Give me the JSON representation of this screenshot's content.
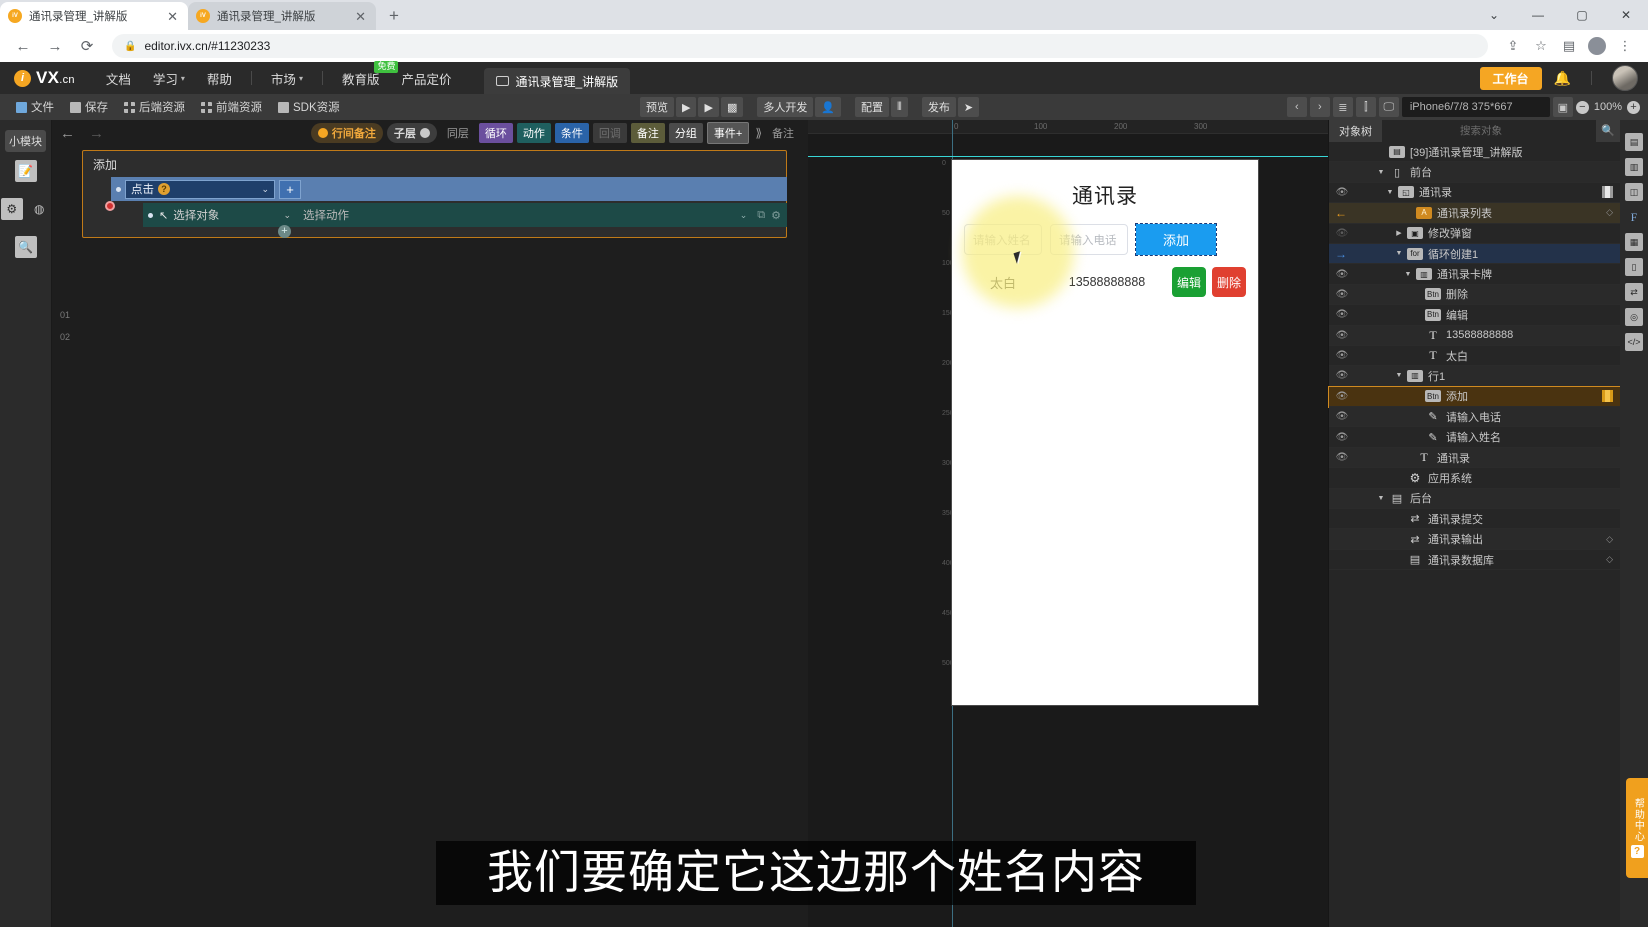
{
  "browser": {
    "tabs": [
      {
        "title": "通讯录管理_讲解版",
        "close": "✕",
        "favicon": "ivx-favicon",
        "active": true
      },
      {
        "title": "通讯录管理_讲解版",
        "close": "✕",
        "favicon": "ivx-favicon",
        "active": false
      }
    ],
    "new_tab_label": "+",
    "window_controls": {
      "minimize": "—",
      "maximize": "▢",
      "close": "✕",
      "chevron": "⌄"
    },
    "nav": {
      "back": "←",
      "forward": "→",
      "reload": "⟳",
      "lock": "🔒"
    },
    "url": "editor.ivx.cn/#11230233",
    "end_icons": {
      "share": "⇪",
      "star": "☆",
      "panel": "▤",
      "profile": "profile-avatar",
      "menu": "⋮"
    }
  },
  "topnav": {
    "logo_mark": "i",
    "logo_text": "VX",
    "logo_suffix": ".cn",
    "items": [
      {
        "label": "文档",
        "caret": false
      },
      {
        "label": "学习",
        "caret": true
      },
      {
        "label": "帮助",
        "caret": false
      },
      {
        "label": "市场",
        "caret": true
      },
      {
        "label": "教育版",
        "caret": false,
        "badge": "免费"
      },
      {
        "label": "产品定价",
        "caret": false
      }
    ],
    "project_tab": "通讯录管理_讲解版",
    "workbench_button": "工作台",
    "bell_icon": "bell-icon",
    "avatar": "user-avatar"
  },
  "toolbar": {
    "left_items": [
      {
        "label": "文件",
        "icon": "folder-icon"
      },
      {
        "label": "保存",
        "icon": "save-icon"
      },
      {
        "label": "后端资源",
        "icon": "backend-resource-icon"
      },
      {
        "label": "前端资源",
        "icon": "frontend-resource-icon"
      },
      {
        "label": "SDK资源",
        "icon": "sdk-resource-icon"
      }
    ],
    "center_items": [
      {
        "label": "预览",
        "icon": "preview-icon"
      },
      {
        "label": "",
        "icon": "play-icon"
      },
      {
        "label": "",
        "icon": "play-alt-icon"
      },
      {
        "label": "",
        "icon": "qr-icon"
      },
      {
        "label": "多人开发",
        "icon": "multi-user-icon"
      },
      {
        "label": "",
        "icon": "user-icon"
      },
      {
        "label": "配置",
        "icon": "config-icon"
      },
      {
        "label": "",
        "icon": "sliders-icon"
      },
      {
        "label": "发布",
        "icon": "publish-icon"
      },
      {
        "label": "",
        "icon": "send-icon"
      }
    ],
    "right": {
      "prev": "‹",
      "next": "›",
      "align_icon": "align-icon",
      "distribute_icon": "distribute-icon",
      "device_icon": "device-icon",
      "device": "iPhone6/7/8 375*667",
      "screenshot_icon": "screenshot-icon",
      "zoom_out": "−",
      "zoom_level": "100%",
      "zoom_in": "+"
    }
  },
  "left_rail": {
    "tab": "小模块",
    "icons": [
      "edit-chart-icon",
      "sliders-icon",
      "palette-icon",
      "inspect-icon"
    ]
  },
  "event_editor": {
    "back_arrow": "←",
    "forward_arrow": "→",
    "toggles": [
      {
        "label": "行间备注",
        "style": "amber"
      },
      {
        "label": "子层",
        "style": "gray"
      }
    ],
    "tags": [
      {
        "label": "同层",
        "style": "plain"
      },
      {
        "label": "循环",
        "style": "loop"
      },
      {
        "label": "动作",
        "style": "action"
      },
      {
        "label": "条件",
        "style": "cond"
      },
      {
        "label": "回调",
        "style": "callback"
      },
      {
        "label": "备注",
        "style": "note"
      },
      {
        "label": "分组",
        "style": "group"
      },
      {
        "label": "事件+",
        "style": "event"
      }
    ],
    "more_chevron": "⟫",
    "more_label": "备注",
    "card_title": "添加",
    "row_numbers": [
      "01",
      "02"
    ],
    "row1": {
      "event_name": "点击",
      "help": "?",
      "chevron": "⌄",
      "add": "+"
    },
    "row2": {
      "object_placeholder": "选择对象",
      "chevron": "⌄",
      "action_placeholder": "选择动作",
      "action_chevron": "⌄",
      "end_icons": [
        "copy-icon",
        "gear-icon"
      ]
    },
    "add_row": "+"
  },
  "stage": {
    "ruler_marks": [
      "0",
      "100",
      "200",
      "300"
    ],
    "ruler_v_marks": [
      "0",
      "50",
      "100",
      "150",
      "200",
      "250",
      "300",
      "350",
      "400",
      "450",
      "500"
    ],
    "phone": {
      "title": "通讯录",
      "name_placeholder": "请输入姓名",
      "phone_placeholder": "请输入电话",
      "add_button": "添加",
      "record": {
        "name": "太白",
        "phone": "13588888888",
        "edit_button": "编辑",
        "delete_button": "删除"
      }
    }
  },
  "tree": {
    "tab": "对象树",
    "search_placeholder": "搜索对象",
    "search_icon": "search-icon",
    "rows": [
      {
        "label": "[39]通讯录管理_讲解版",
        "indent": 2,
        "icon": "project-icon",
        "eye": false,
        "arrow": "",
        "mark": "",
        "end": ""
      },
      {
        "label": "前台",
        "indent": 2,
        "icon": "phone-icon",
        "eye": false,
        "arrow": "▼",
        "mark": "",
        "end": ""
      },
      {
        "label": "通讯录",
        "indent": 3,
        "icon": "page-icon",
        "eye": true,
        "arrow": "▼",
        "mark": "",
        "end": "book"
      },
      {
        "label": "通讯录列表",
        "indent": 5,
        "icon": "list-icon-orange",
        "eye": false,
        "arrow": "",
        "mark": "orange",
        "end": "dot"
      },
      {
        "label": "修改弹窗",
        "indent": 4,
        "icon": "popup-icon",
        "eye": "off",
        "arrow": "▶",
        "mark": "",
        "end": ""
      },
      {
        "label": "循环创建1",
        "indent": 4,
        "icon": "loop-icon",
        "eye": false,
        "arrow": "▼",
        "mark": "blue",
        "end": ""
      },
      {
        "label": "通讯录卡牌",
        "indent": 5,
        "icon": "card-icon",
        "eye": true,
        "arrow": "▼",
        "mark": "",
        "end": ""
      },
      {
        "label": "删除",
        "indent": 6,
        "icon": "button-icon",
        "eye": true,
        "arrow": "",
        "mark": "",
        "end": ""
      },
      {
        "label": "编辑",
        "indent": 6,
        "icon": "button-icon",
        "eye": true,
        "arrow": "",
        "mark": "",
        "end": ""
      },
      {
        "label": "13588888888",
        "indent": 6,
        "icon": "text-icon",
        "eye": true,
        "arrow": "",
        "mark": "",
        "end": ""
      },
      {
        "label": "太白",
        "indent": 6,
        "icon": "text-icon",
        "eye": true,
        "arrow": "",
        "mark": "",
        "end": ""
      },
      {
        "label": "行1",
        "indent": 4,
        "icon": "row-icon",
        "eye": true,
        "arrow": "▼",
        "mark": "",
        "end": ""
      },
      {
        "label": "添加",
        "indent": 6,
        "icon": "button-icon",
        "eye": true,
        "arrow": "",
        "mark": "",
        "end": "book-amber",
        "selected": true
      },
      {
        "label": "请输入电话",
        "indent": 6,
        "icon": "input-icon",
        "eye": true,
        "arrow": "",
        "mark": "",
        "end": ""
      },
      {
        "label": "请输入姓名",
        "indent": 6,
        "icon": "input-icon",
        "eye": true,
        "arrow": "",
        "mark": "",
        "end": ""
      },
      {
        "label": "通讯录",
        "indent": 5,
        "icon": "text-icon",
        "eye": true,
        "arrow": "",
        "mark": "",
        "end": ""
      },
      {
        "label": "应用系统",
        "indent": 4,
        "icon": "gear-icon",
        "eye": false,
        "arrow": "",
        "mark": "",
        "end": ""
      },
      {
        "label": "后台",
        "indent": 2,
        "icon": "server-icon",
        "eye": false,
        "arrow": "▼",
        "mark": "",
        "end": ""
      },
      {
        "label": "通讯录提交",
        "indent": 4,
        "icon": "service-icon",
        "eye": false,
        "arrow": "",
        "mark": "",
        "end": ""
      },
      {
        "label": "通讯录输出",
        "indent": 4,
        "icon": "service-icon",
        "eye": false,
        "arrow": "",
        "mark": "",
        "end": "dot"
      },
      {
        "label": "通讯录数据库",
        "indent": 4,
        "icon": "database-icon",
        "eye": false,
        "arrow": "",
        "mark": "",
        "end": "dot"
      }
    ]
  },
  "far_rail": {
    "icons": [
      "properties-icon",
      "styles-icon",
      "data-icon",
      "font-icon",
      "layers-icon",
      "mobile-icon",
      "transfer-icon",
      "component-icon",
      "code-icon"
    ]
  },
  "subtitle": "我们要确定它这边那个姓名内容",
  "help_tab": {
    "label": "帮助中心",
    "icon": "?"
  },
  "colors": {
    "accent_orange": "#f5a623",
    "primary_blue": "#1a9cf0",
    "success_green": "#1aa033",
    "danger_red": "#e04030",
    "selection_amber": "#d08a20"
  }
}
